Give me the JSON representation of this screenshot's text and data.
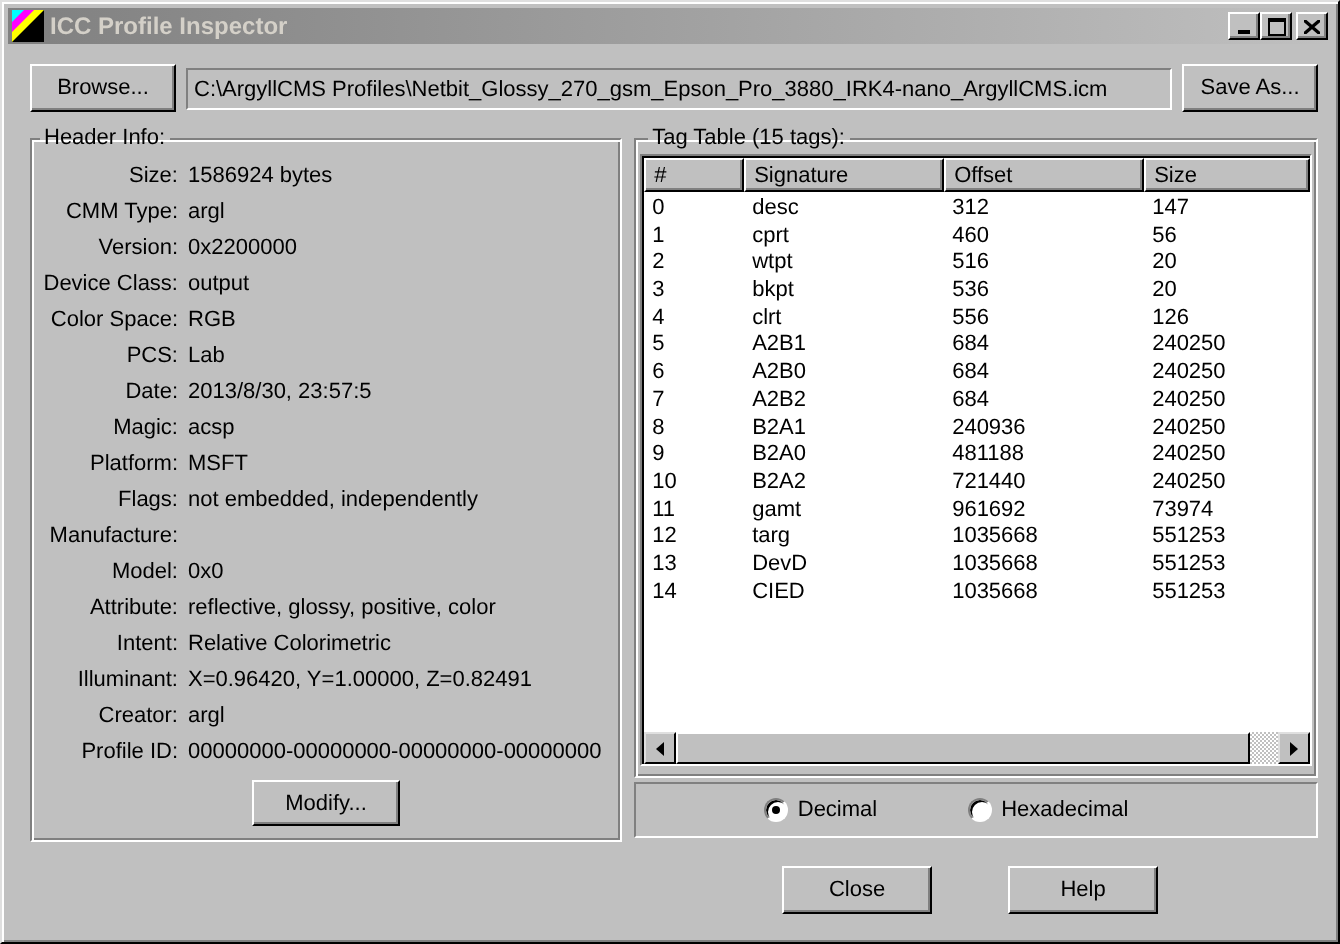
{
  "window": {
    "title": "ICC Profile Inspector"
  },
  "file_bar": {
    "browse_button": "Browse...",
    "path": "C:\\ArgyllCMS Profiles\\Netbit_Glossy_270_gsm_Epson_Pro_3880_IRK4-nano_ArgyllCMS.icm",
    "save_button": "Save As..."
  },
  "header_info": {
    "title": "Header Info:",
    "fields": [
      {
        "label": "Size:",
        "value": "1586924 bytes"
      },
      {
        "label": "CMM Type:",
        "value": "argl"
      },
      {
        "label": "Version:",
        "value": "0x2200000"
      },
      {
        "label": "Device Class:",
        "value": "output"
      },
      {
        "label": "Color Space:",
        "value": "RGB"
      },
      {
        "label": "PCS:",
        "value": "Lab"
      },
      {
        "label": "Date:",
        "value": "2013/8/30, 23:57:5"
      },
      {
        "label": "Magic:",
        "value": "acsp"
      },
      {
        "label": "Platform:",
        "value": "MSFT"
      },
      {
        "label": "Flags:",
        "value": "not embedded, independently"
      },
      {
        "label": "Manufacture:"
      },
      {
        "label": "Model:",
        "value": "0x0"
      },
      {
        "label": "Attribute:",
        "value": "reflective, glossy, positive, color"
      },
      {
        "label": "Intent:",
        "value": "Relative Colorimetric"
      },
      {
        "label": "Illuminant:",
        "value": "X=0.96420, Y=1.00000, Z=0.82491"
      },
      {
        "label": "Creator:",
        "value": "argl"
      },
      {
        "label": "Profile ID:",
        "value": "00000000-00000000-00000000-00000000"
      }
    ],
    "modify_button": "Modify..."
  },
  "tag_table": {
    "title": "Tag Table (15 tags):",
    "columns": [
      "#",
      "Signature",
      "Offset",
      "Size"
    ],
    "rows": [
      [
        "0",
        "desc",
        "312",
        "147"
      ],
      [
        "1",
        "cprt",
        "460",
        "56"
      ],
      [
        "2",
        "wtpt",
        "516",
        "20"
      ],
      [
        "3",
        "bkpt",
        "536",
        "20"
      ],
      [
        "4",
        "clrt",
        "556",
        "126"
      ],
      [
        "5",
        "A2B1",
        "684",
        "240250"
      ],
      [
        "6",
        "A2B0",
        "684",
        "240250"
      ],
      [
        "7",
        "A2B2",
        "684",
        "240250"
      ],
      [
        "8",
        "B2A1",
        "240936",
        "240250"
      ],
      [
        "9",
        "B2A0",
        "481188",
        "240250"
      ],
      [
        "10",
        "B2A2",
        "721440",
        "240250"
      ],
      [
        "11",
        "gamt",
        "961692",
        "73974"
      ],
      [
        "12",
        "targ",
        "1035668",
        "551253"
      ],
      [
        "13",
        "DevD",
        "1035668",
        "551253"
      ],
      [
        "14",
        "CIED",
        "1035668",
        "551253"
      ]
    ],
    "number_format": [
      {
        "label": "Decimal",
        "selected": true
      },
      {
        "label": "Hexadecimal",
        "selected": false
      }
    ]
  },
  "buttons": [
    "Close",
    "Help"
  ]
}
